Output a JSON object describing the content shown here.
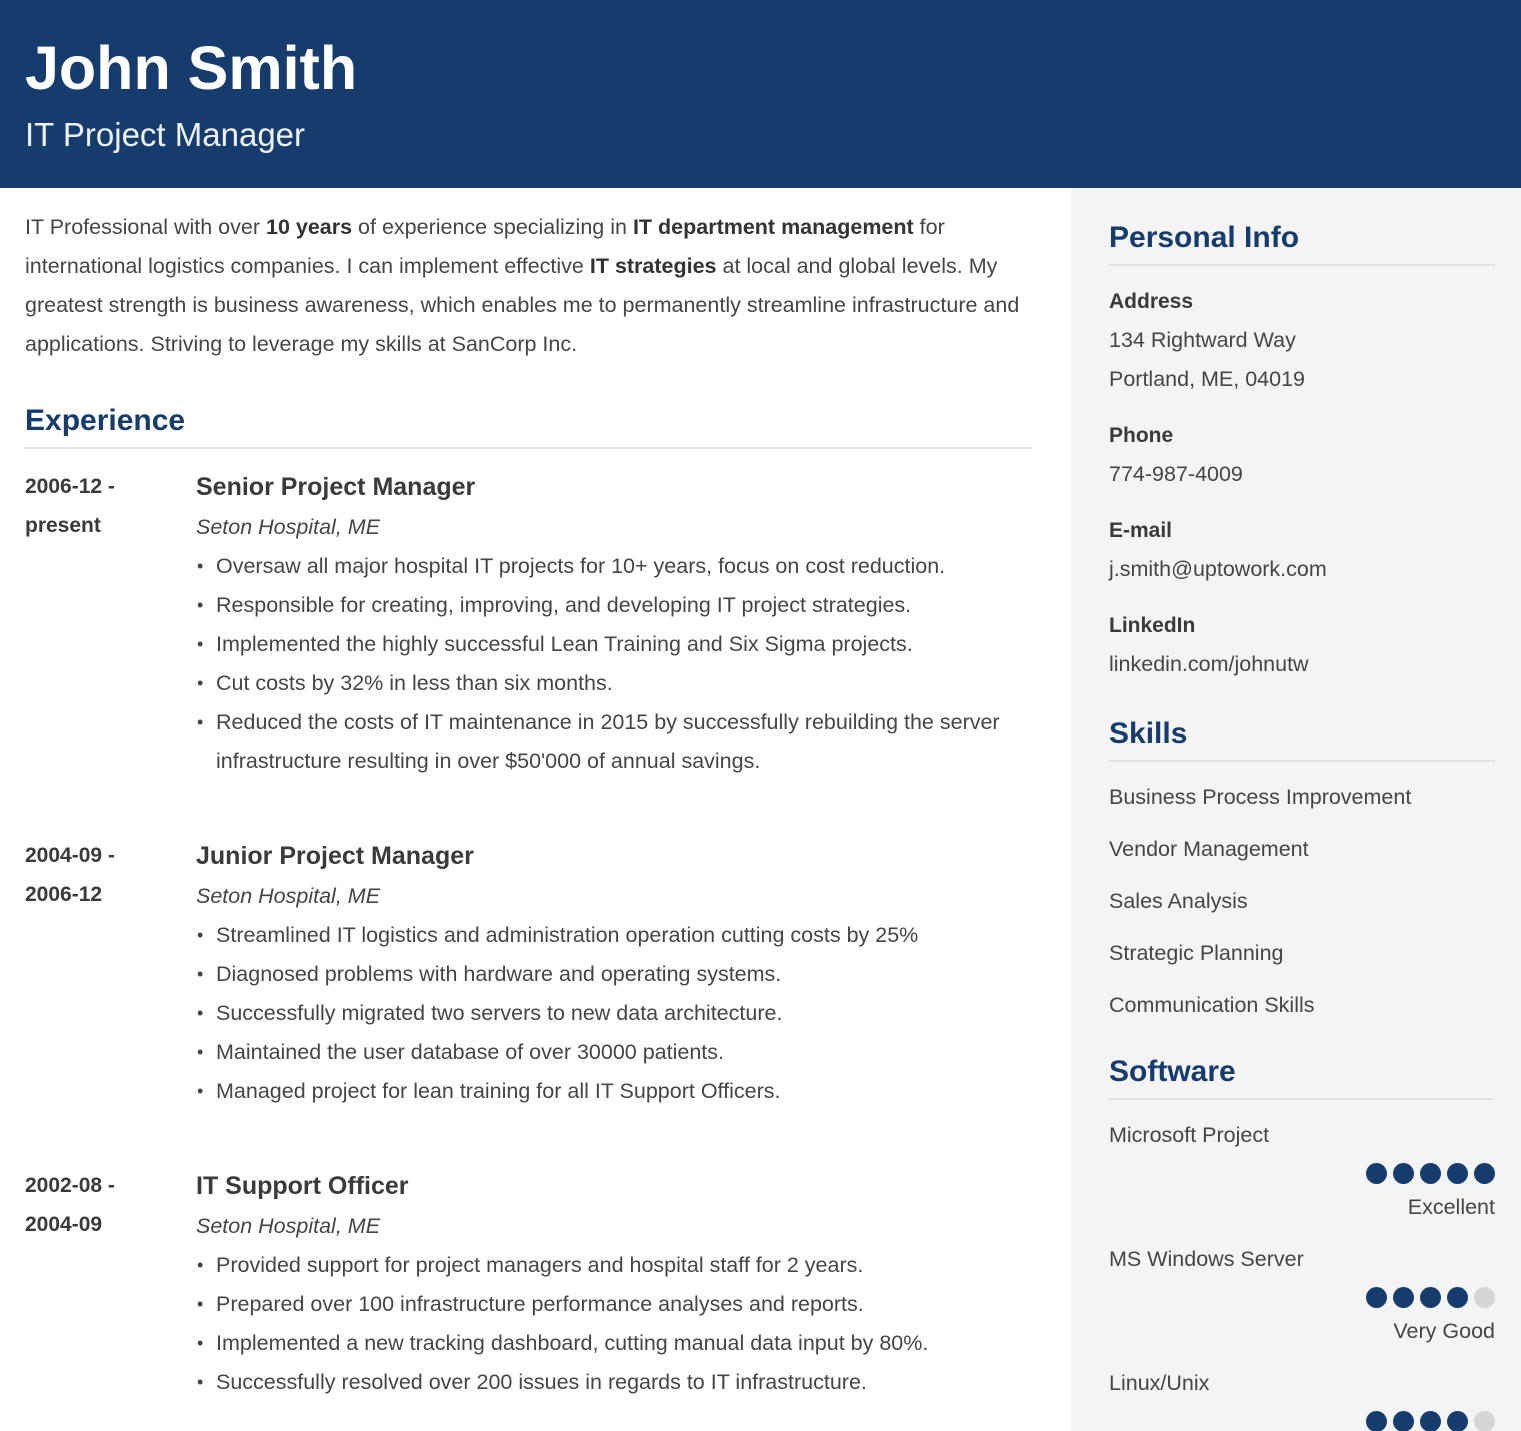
{
  "header": {
    "name": "John Smith",
    "title": "IT Project Manager"
  },
  "colors": {
    "accent": "#163c6e",
    "sidebar_bg": "#f4f4f4",
    "dot_off": "#d6d6d6"
  },
  "summary": {
    "parts": [
      {
        "t": "IT Professional with over ",
        "b": false
      },
      {
        "t": "10 years",
        "b": true
      },
      {
        "t": " of experience specializing in ",
        "b": false
      },
      {
        "t": "IT department management",
        "b": true
      },
      {
        "t": " for international logistics companies. I can implement effective ",
        "b": false
      },
      {
        "t": "IT strategies",
        "b": true
      },
      {
        "t": " at local and global levels. My greatest strength is business awareness, which enables me to permanently streamline infrastructure and applications. Striving to leverage my skills at SanCorp Inc.",
        "b": false
      }
    ]
  },
  "experience": {
    "title": "Experience",
    "jobs": [
      {
        "date_start": "2006-12 -",
        "date_end": "present",
        "role": "Senior Project Manager",
        "company": "Seton Hospital, ME",
        "bullets": [
          "Oversaw all major hospital IT projects for 10+ years, focus on cost reduction.",
          "Responsible for creating, improving, and developing IT project strategies.",
          "Implemented the highly successful Lean Training and Six Sigma projects.",
          "Cut costs by 32% in less than six months.",
          "Reduced the costs of IT maintenance in 2015 by successfully rebuilding the server infrastructure resulting in over $50'000 of annual savings."
        ]
      },
      {
        "date_start": "2004-09 -",
        "date_end": "2006-12",
        "role": "Junior Project Manager",
        "company": "Seton Hospital, ME",
        "bullets": [
          "Streamlined IT logistics and administration operation cutting costs by 25%",
          "Diagnosed problems with hardware and operating systems.",
          "Successfully migrated two servers to new data architecture.",
          "Maintained the user database of over 30000 patients.",
          "Managed project for lean training for all IT Support Officers."
        ]
      },
      {
        "date_start": "2002-08 -",
        "date_end": "2004-09",
        "role": "IT Support Officer",
        "company": "Seton Hospital, ME",
        "bullets": [
          "Provided support for project managers and hospital staff for 2 years.",
          "Prepared over 100 infrastructure performance analyses and reports.",
          "Implemented a new tracking dashboard, cutting manual data input by 80%.",
          "Successfully resolved over 200 issues in regards to IT infrastructure."
        ]
      }
    ]
  },
  "personal_info": {
    "title": "Personal Info",
    "items": [
      {
        "label": "Address",
        "values": [
          "134 Rightward Way",
          "Portland, ME, 04019"
        ]
      },
      {
        "label": "Phone",
        "values": [
          "774-987-4009"
        ]
      },
      {
        "label": "E-mail",
        "values": [
          "j.smith@uptowork.com"
        ]
      },
      {
        "label": "LinkedIn",
        "values": [
          "linkedin.com/johnutw"
        ]
      }
    ]
  },
  "skills": {
    "title": "Skills",
    "items": [
      "Business Process Improvement",
      "Vendor Management",
      "Sales Analysis",
      "Strategic Planning",
      "Communication Skills"
    ]
  },
  "software": {
    "title": "Software",
    "items": [
      {
        "name": "Microsoft Project",
        "rating": 5,
        "max": 5,
        "level": "Excellent"
      },
      {
        "name": "MS Windows Server",
        "rating": 4,
        "max": 5,
        "level": "Very Good"
      },
      {
        "name": "Linux/Unix",
        "rating": 4,
        "max": 5,
        "level": ""
      }
    ]
  }
}
